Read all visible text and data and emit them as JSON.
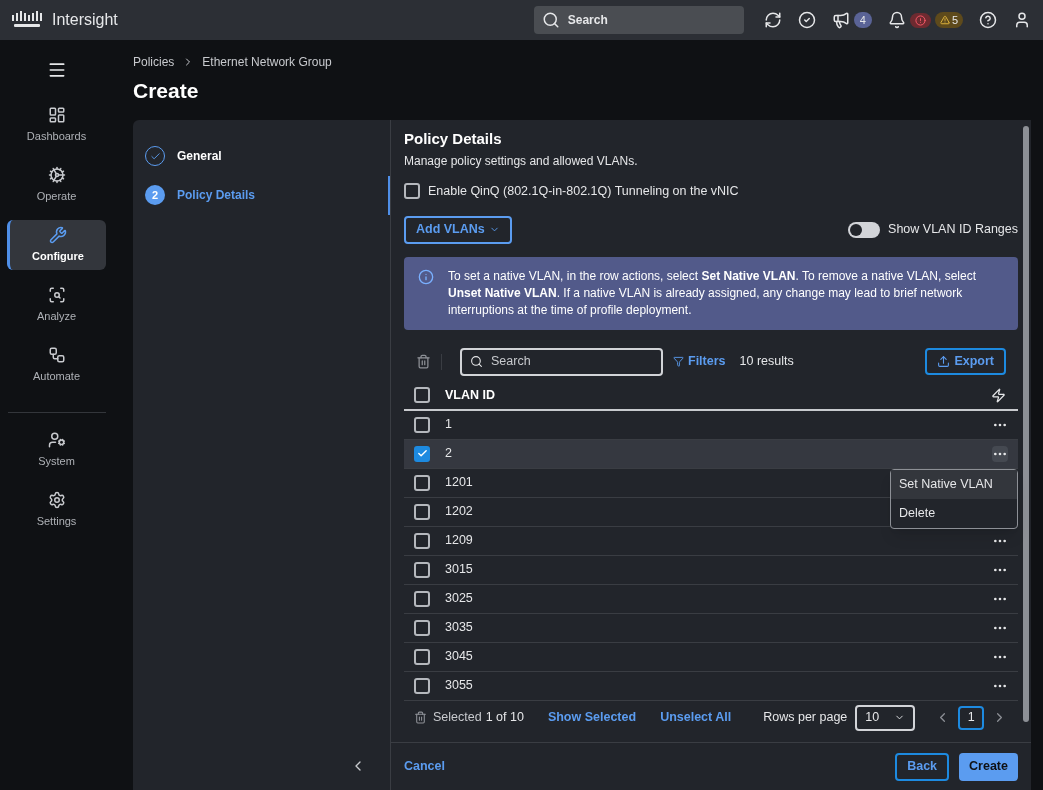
{
  "app": {
    "brand": "Intersight"
  },
  "topbar": {
    "search_placeholder": "Search",
    "announcements": "4",
    "warnings": "5"
  },
  "nav": [
    {
      "label": "Dashboards",
      "kind": "dashboards",
      "selected": false
    },
    {
      "label": "Operate",
      "kind": "operate",
      "selected": false
    },
    {
      "label": "Configure",
      "kind": "configure",
      "selected": true
    },
    {
      "label": "Analyze",
      "kind": "analyze",
      "selected": false
    },
    {
      "label": "Automate",
      "kind": "automate",
      "selected": false
    },
    {
      "label": "System",
      "kind": "system",
      "selected": false
    },
    {
      "label": "Settings",
      "kind": "settings",
      "selected": false
    }
  ],
  "breadcrumbs": [
    "Policies",
    "Ethernet Network Group"
  ],
  "title": "Create",
  "steps": [
    {
      "label": "General",
      "kind": "done",
      "selected": false
    },
    {
      "label": "Policy Details",
      "kind": "number",
      "number": "2",
      "selected": true
    }
  ],
  "details": {
    "title": "Policy Details",
    "description": "Manage policy settings and allowed VLANs.",
    "qinq": {
      "label": "Enable QinQ (802.1Q-in-802.1Q) Tunneling on the vNIC",
      "checked": false
    },
    "add_button": "Add VLANs",
    "toggle": {
      "label": "Show VLAN ID Ranges",
      "on": false
    },
    "info": "To set a native VLAN, in the row actions, select **Set Native VLAN**. To remove a native VLAN, select **Unset Native VLAN**. If a native VLAN is already assigned, any change may lead to brief network interruptions at the time of profile deployment."
  },
  "table": {
    "search_placeholder": "Search",
    "filters": "Filters",
    "results": "10 results",
    "export": "Export",
    "column": "VLAN ID",
    "all_checked": false,
    "rows": [
      {
        "id": "1",
        "checked": false,
        "menu_open": false
      },
      {
        "id": "2",
        "checked": true,
        "menu_open": true
      },
      {
        "id": "1201",
        "checked": false,
        "menu_open": false
      },
      {
        "id": "1202",
        "checked": false,
        "menu_open": false
      },
      {
        "id": "1209",
        "checked": false,
        "menu_open": false
      },
      {
        "id": "3015",
        "checked": false,
        "menu_open": false
      },
      {
        "id": "3025",
        "checked": false,
        "menu_open": false
      },
      {
        "id": "3035",
        "checked": false,
        "menu_open": false
      },
      {
        "id": "3045",
        "checked": false,
        "menu_open": false
      },
      {
        "id": "3055",
        "checked": false,
        "menu_open": false
      }
    ],
    "menu": [
      {
        "label": "Set Native VLAN",
        "selected": true
      },
      {
        "label": "Delete",
        "selected": false
      }
    ],
    "footer": {
      "selected_label": "Selected",
      "selected_count": "1 of 10",
      "show_selected": "Show Selected",
      "unselect_all": "Unselect All",
      "rows_per_page": "Rows per page",
      "rows_value": "10",
      "page": "1"
    }
  },
  "actions": {
    "cancel": "Cancel",
    "back": "Back",
    "create": "Create"
  }
}
